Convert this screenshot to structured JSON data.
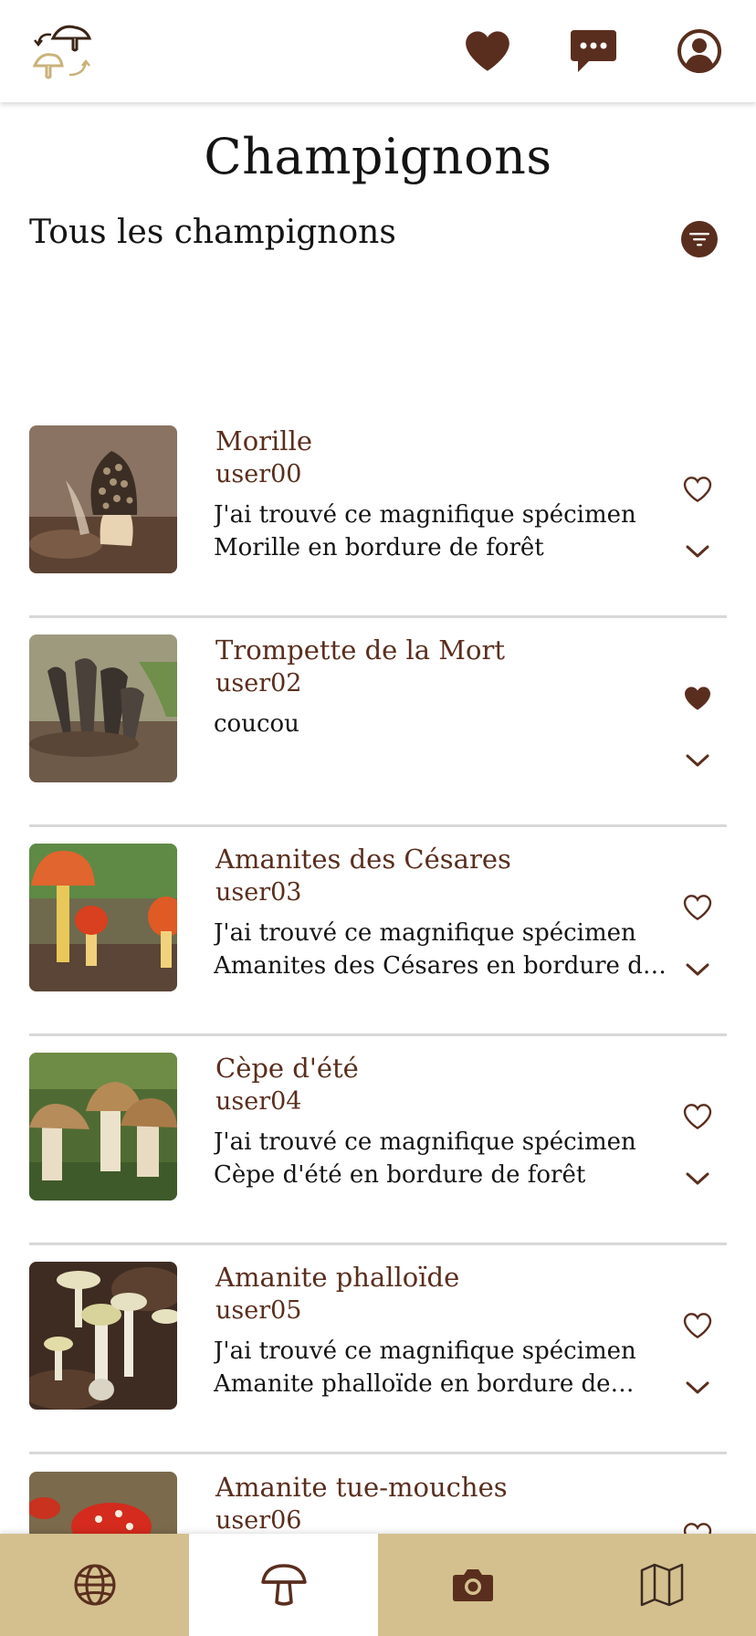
{
  "header": {
    "logo_icon": "mushroom-swap-logo-icon",
    "favorites_icon": "heart-filled-icon",
    "messages_icon": "chat-bubble-icon",
    "profile_icon": "user-circle-icon"
  },
  "page": {
    "title": "Champignons",
    "section_title": "Tous les champignons",
    "filter_icon": "filter-icon"
  },
  "colors": {
    "brand_brown": "#5a2e1e",
    "nav_tan": "#d4c08e",
    "divider": "#d8d8d8"
  },
  "items": [
    {
      "name": "Morille",
      "user": "user00",
      "description": "J'ai trouvé ce magnifique spécimen Morille en bordure de forêt",
      "liked": false
    },
    {
      "name": "Trompette de la Mort",
      "user": "user02",
      "description": "coucou",
      "liked": true
    },
    {
      "name": "Amanites des Césares",
      "user": "user03",
      "description": "J'ai trouvé ce magnifique spécimen Amanites des Césares en bordure de forêt",
      "liked": false
    },
    {
      "name": "Cèpe d'été",
      "user": "user04",
      "description": "J'ai trouvé ce magnifique spécimen Cèpe d'été en bordure de forêt",
      "liked": false
    },
    {
      "name": "Amanite phalloïde",
      "user": "user05",
      "description": "J'ai trouvé ce magnifique spécimen Amanite phalloïde en bordure de forêt",
      "liked": false
    },
    {
      "name": "Amanite tue-mouches",
      "user": "user06",
      "description": "",
      "liked": false
    }
  ],
  "bottom_nav": [
    {
      "icon": "globe-icon",
      "active": false
    },
    {
      "icon": "mushroom-icon",
      "active": true
    },
    {
      "icon": "camera-icon",
      "active": false
    },
    {
      "icon": "map-icon",
      "active": false
    }
  ]
}
